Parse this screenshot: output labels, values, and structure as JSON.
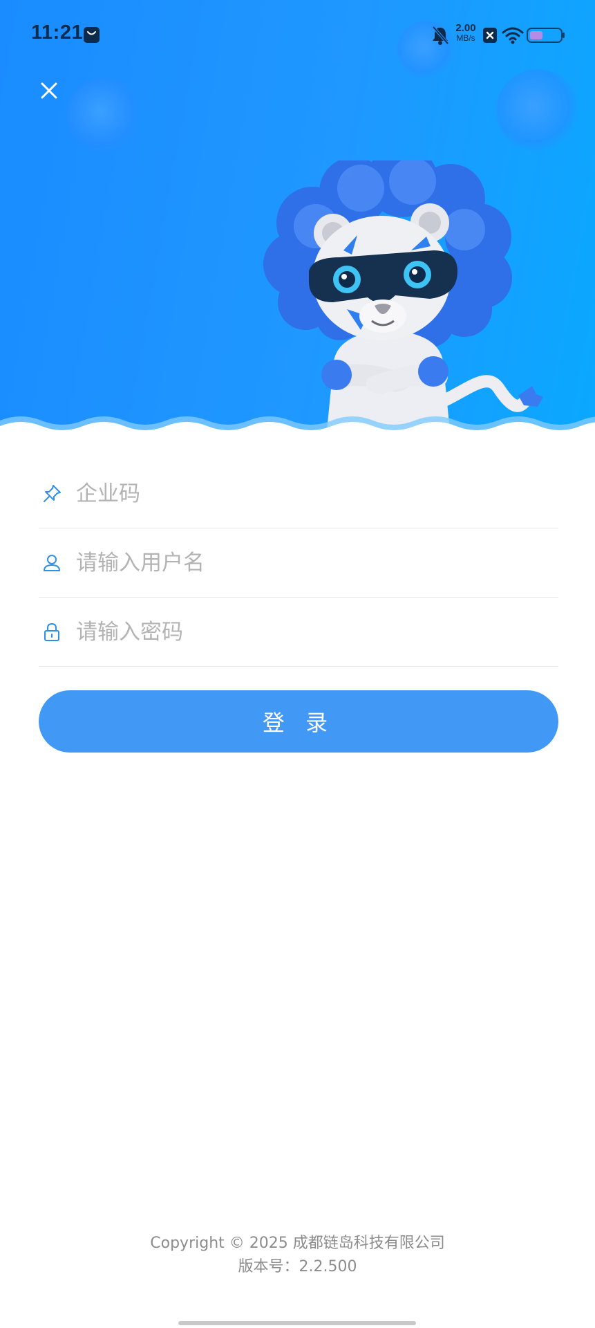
{
  "status_bar": {
    "time": "11:21",
    "net_speed_value": "2.00",
    "net_speed_unit": "MB/s",
    "icons": [
      "shopping-bag-icon",
      "bell-muted-icon",
      "sim-icon",
      "wifi-icon",
      "battery-icon"
    ]
  },
  "header": {
    "close_icon": "close-icon",
    "mascot": "lion-mascot"
  },
  "form": {
    "company_code": {
      "placeholder": "企业码",
      "value": "",
      "icon": "pin-icon"
    },
    "username": {
      "placeholder": "请输入用户名",
      "value": "",
      "icon": "user-icon"
    },
    "password": {
      "placeholder": "请输入密码",
      "value": "",
      "icon": "lock-icon"
    },
    "login_label": "登 录"
  },
  "footer": {
    "copyright": "Copyright © 2025 成都链岛科技有限公司",
    "version": "版本号：2.2.500"
  },
  "colors": {
    "hero_start": "#1a8cff",
    "hero_end": "#0aa8ff",
    "button": "#4199f5",
    "icon": "#2f8fe6",
    "placeholder": "#b3b3b3"
  }
}
